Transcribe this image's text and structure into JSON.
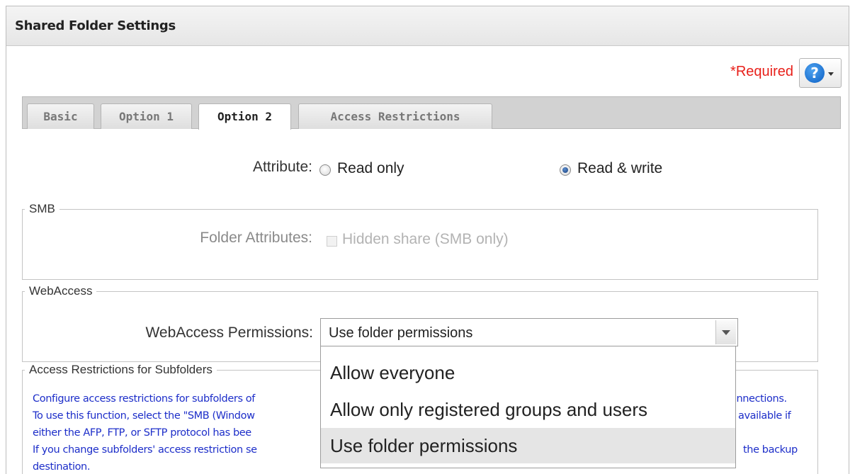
{
  "panel": {
    "title": "Shared Folder Settings",
    "required_label": "*Required",
    "help_icon": "question-circle-icon",
    "help_caret_icon": "chevron-down-icon"
  },
  "tabs": [
    {
      "label": "Basic",
      "active": false
    },
    {
      "label": "Option 1",
      "active": false
    },
    {
      "label": "Option 2",
      "active": true
    },
    {
      "label": "Access Restrictions",
      "active": false
    }
  ],
  "attribute": {
    "label": "Attribute:",
    "options": [
      {
        "label": "Read only",
        "checked": false
      },
      {
        "label": "Read & write",
        "checked": true
      }
    ]
  },
  "smb": {
    "legend": "SMB",
    "folder_attributes_label": "Folder Attributes:",
    "hidden_share_label": "Hidden share (SMB only)",
    "hidden_share_checked": false,
    "hidden_share_disabled": true
  },
  "webaccess": {
    "legend": "WebAccess",
    "permissions_label": "WebAccess Permissions:",
    "selected": "Use folder permissions",
    "options": [
      {
        "label": "Allow everyone",
        "selected": false
      },
      {
        "label": "Allow only registered groups and users",
        "selected": false
      },
      {
        "label": "Use folder permissions",
        "selected": true
      }
    ]
  },
  "subfolders": {
    "legend": "Access Restrictions for Subfolders",
    "lines_left": [
      "Configure access restrictions for subfolders of",
      "To use this function, select the \"SMB (Window",
      "either the AFP, FTP, or SFTP protocol has bee",
      "If you change subfolders' access restriction se",
      "destination."
    ],
    "lines_right": [
      "onnections.",
      "available if",
      "",
      "the backup"
    ]
  },
  "colors": {
    "required": "#e8201a",
    "info_text": "#1d2ec9",
    "help_blue": "#0b5fc4"
  }
}
